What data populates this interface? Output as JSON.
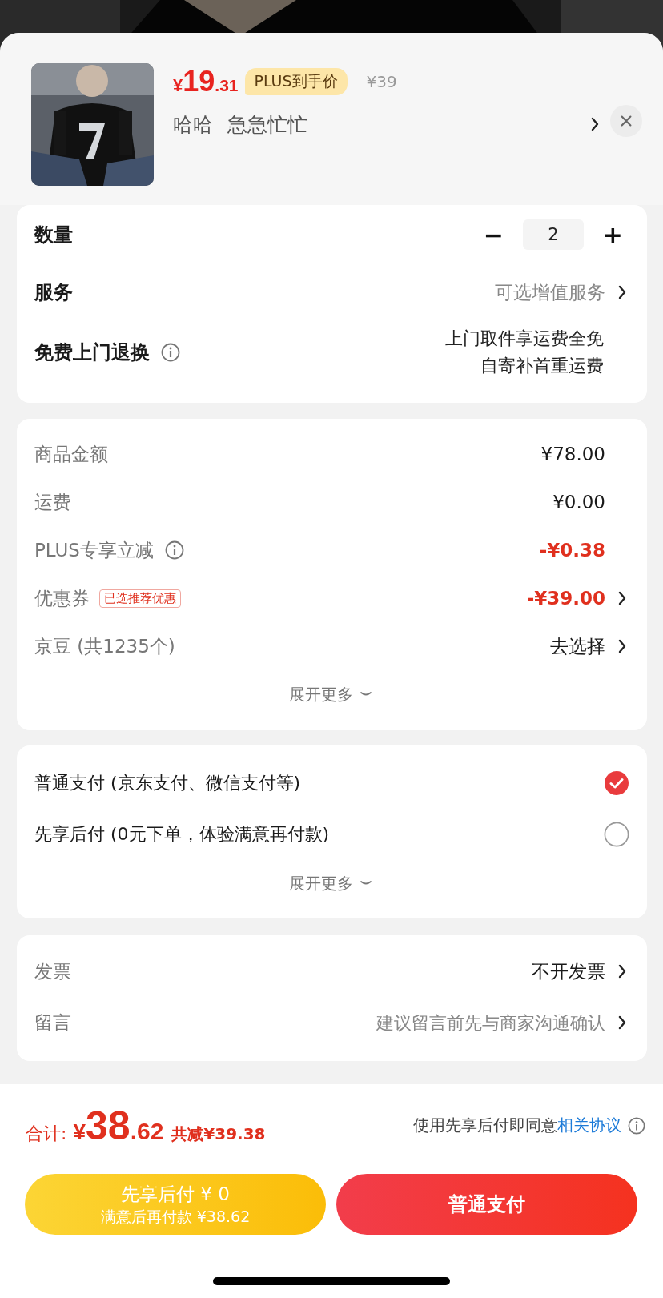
{
  "product": {
    "currency": "¥",
    "price_integer": "19",
    "price_decimal": ".31",
    "badge": "PLUS到手价",
    "original_price": "¥39",
    "specs": [
      "哈哈",
      "急急忙忙"
    ]
  },
  "options": {
    "quantity": {
      "label": "数量",
      "minus": "−",
      "value": "2",
      "plus": "+"
    },
    "service": {
      "label": "服务",
      "value": "可选增值服务"
    },
    "returns": {
      "label": "免费上门退换",
      "lines": [
        "上门取件享运费全免",
        "自寄补首重运费"
      ]
    }
  },
  "costs": {
    "rows": [
      {
        "label": "商品金额",
        "info": false,
        "value": "¥78.00",
        "discount": false,
        "arrow": false
      },
      {
        "label": "运费",
        "info": false,
        "value": "¥0.00",
        "discount": false,
        "arrow": false
      },
      {
        "label": "PLUS专享立减",
        "info": true,
        "value": "-¥0.38",
        "discount": true,
        "arrow": false
      },
      {
        "label": "优惠券",
        "info": false,
        "tag": "已选推荐优惠",
        "value": "-¥39.00",
        "discount": true,
        "arrow": true
      },
      {
        "label": "京豆 (共1235个)",
        "info": false,
        "value": "去选择",
        "discount": false,
        "arrow": true
      }
    ],
    "more": "展开更多"
  },
  "payment": {
    "methods": [
      {
        "label": "普通支付 (京东支付、微信支付等)",
        "selected": true
      },
      {
        "label": "先享后付 (0元下单，体验满意再付款)",
        "selected": false
      }
    ],
    "more": "展开更多"
  },
  "extras": {
    "invoice": {
      "label": "发票",
      "value": "不开发票"
    },
    "message": {
      "label": "留言",
      "placeholder": "建议留言前先与商家沟通确认"
    }
  },
  "footer": {
    "total_label": "合计:",
    "currency": "¥",
    "total_integer": "38",
    "total_decimal": ".62",
    "saved": "共减¥39.38",
    "agreement_text": "使用先享后付即同意",
    "agreement_link": "相关协议",
    "pay_later": {
      "title": "先享后付 ¥ 0",
      "subtitle": "满意后再付款 ¥38.62"
    },
    "pay_now": "普通支付"
  }
}
